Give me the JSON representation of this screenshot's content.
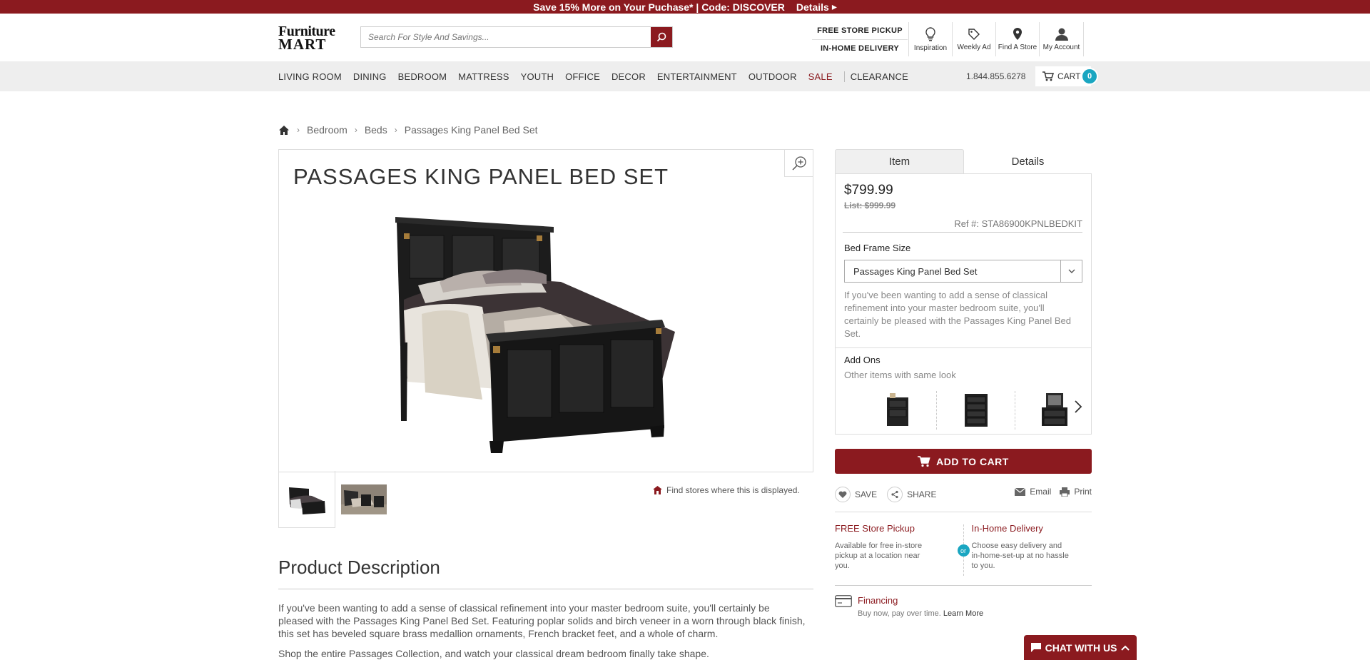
{
  "promo": {
    "text": "Save 15% More on Your Puchase* | Code: DISCOVER",
    "details": "Details"
  },
  "header": {
    "logo_line1": "Furniture",
    "logo_line2": "MART",
    "search_placeholder": "Search For Style And Savings...",
    "services": [
      "FREE STORE PICKUP",
      "IN-HOME DELIVERY"
    ],
    "icons": [
      {
        "label": "Inspiration",
        "icon": "lightbulb-icon"
      },
      {
        "label": "Weekly Ad",
        "icon": "tag-icon"
      },
      {
        "label": "Find A Store",
        "icon": "map-pin-icon"
      },
      {
        "label": "My Account",
        "icon": "user-icon"
      }
    ]
  },
  "nav": {
    "items": [
      "LIVING ROOM",
      "DINING",
      "BEDROOM",
      "MATTRESS",
      "YOUTH",
      "OFFICE",
      "DECOR",
      "ENTERTAINMENT",
      "OUTDOOR",
      "SALE",
      "CLEARANCE"
    ],
    "phone": "1.844.855.6278",
    "cart_label": "CART",
    "cart_count": "0"
  },
  "breadcrumb": [
    "Bedroom",
    "Beds",
    "Passages King Panel Bed Set"
  ],
  "product": {
    "title": "PASSAGES KING PANEL BED SET",
    "find_stores": "Find stores where this is displayed.",
    "description_heading": "Product Description",
    "description": "If you've been wanting to add a sense of classical refinement into your master bedroom suite, you'll certainly be pleased with the Passages King Panel Bed Set. Featuring poplar solids and birch veneer in a worn through black finish, this set has beveled square brass medallion ornaments, French bracket feet, and a whole of charm.",
    "description2": "Shop the entire Passages Collection, and watch your classical dream bedroom finally take shape."
  },
  "panel": {
    "tabs": [
      "Item",
      "Details"
    ],
    "price": "$799.99",
    "list_price": "List: $999.99",
    "ref": "Ref #: STA86900KPNLBEDKIT",
    "size_label": "Bed Frame Size",
    "size_value": "Passages King Panel Bed Set",
    "summary": "If you've been wanting to add a sense of classical refinement into your master bedroom suite, you'll certainly be pleased with the Passages King Panel Bed Set.",
    "addons_title": "Add Ons",
    "addons_sub": "Other items with same look",
    "add_to_cart": "ADD TO CART",
    "save": "SAVE",
    "share": "SHARE",
    "email": "Email",
    "print": "Print",
    "pickup_title": "FREE Store Pickup",
    "pickup_text": "Available for free in-store pickup at a location near you.",
    "or": "or",
    "delivery_title": "In-Home Delivery",
    "delivery_text": "Choose easy delivery and in-home-set-up at no hassle to you.",
    "financing_title": "Financing",
    "financing_text": "Buy now, pay over time.",
    "financing_link": "Learn More"
  },
  "chat": "CHAT WITH US",
  "colors": {
    "brand": "#8b1a1f",
    "accent": "#1aa6c1"
  }
}
